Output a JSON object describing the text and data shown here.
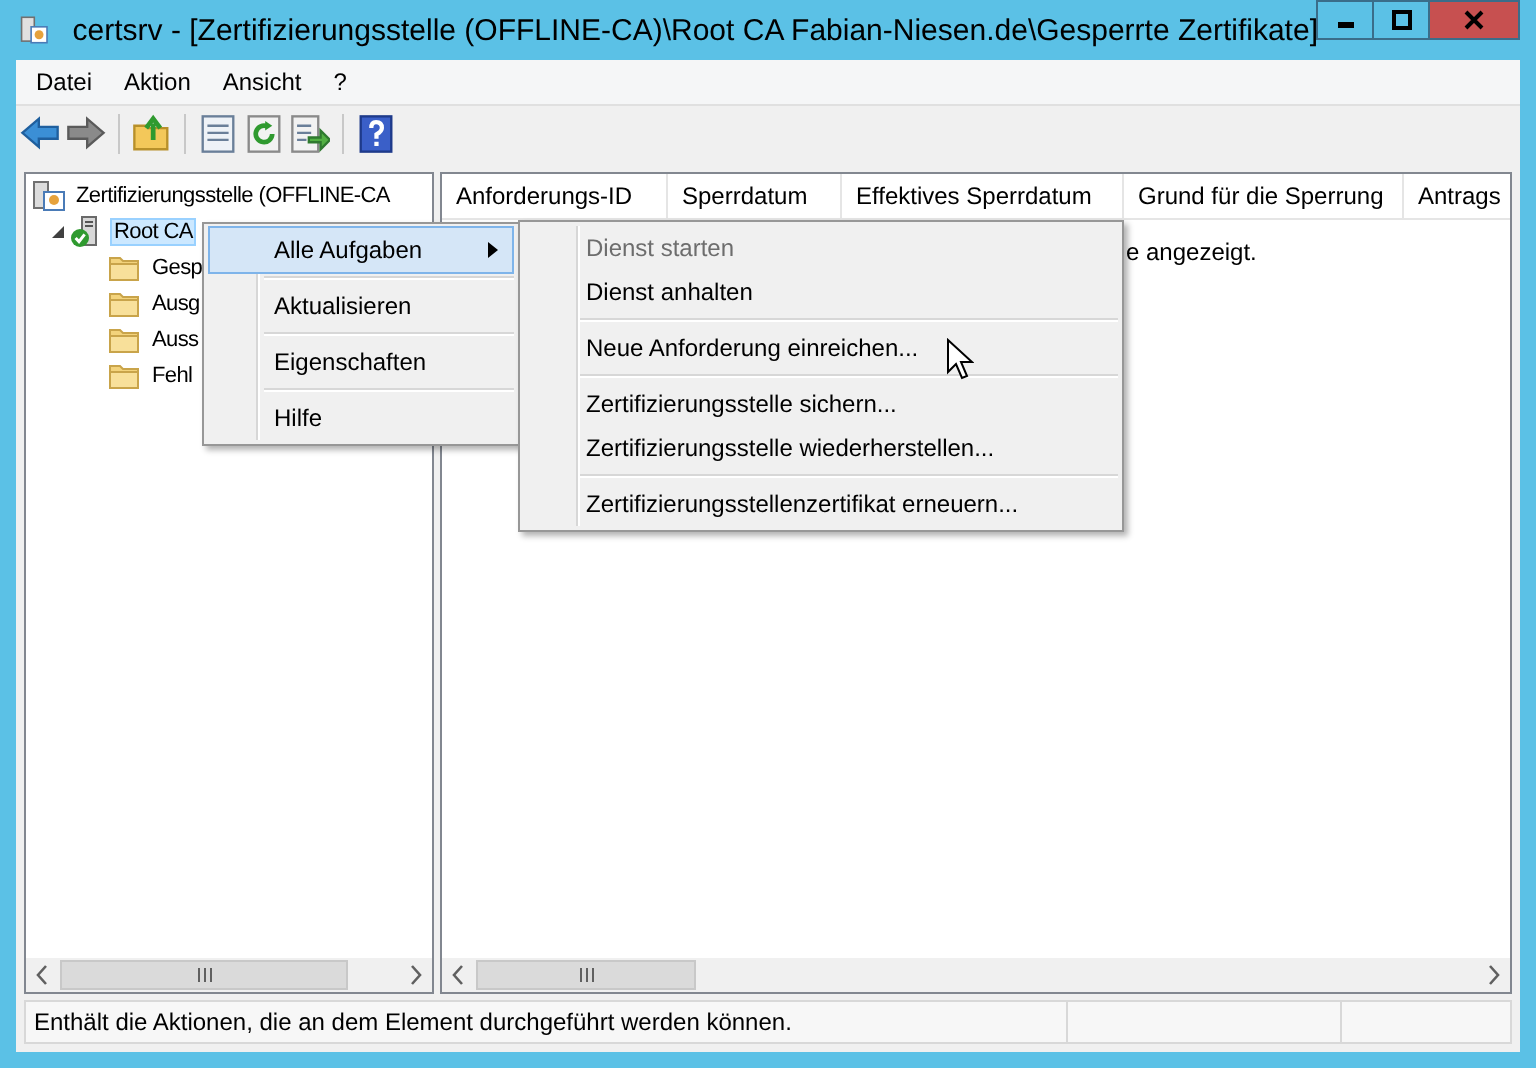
{
  "window": {
    "title": "certsrv - [Zertifizierungsstelle (OFFLINE-CA)\\Root CA Fabian-Niesen.de\\Gesperrte Zertifikate]"
  },
  "menu_bar": [
    "Datei",
    "Aktion",
    "Ansicht",
    "?"
  ],
  "tree": [
    {
      "label": "Zertifizierungsstelle (OFFLINE-CA",
      "selected": false,
      "children": [
        {
          "label": "Root CA",
          "selected": true,
          "expanded": true,
          "children": [
            {
              "label": "Gesp",
              "selected": false
            },
            {
              "label": "Ausg",
              "selected": false
            },
            {
              "label": "Auss",
              "selected": false
            },
            {
              "label": "Fehl",
              "selected": false
            }
          ]
        }
      ]
    }
  ],
  "table": {
    "columns": [
      "Anforderungs-ID",
      "Sperrdatum",
      "Effektives Sperrdatum",
      "Grund für die Sperrung",
      "Antrags"
    ],
    "message": "e angezeigt."
  },
  "context_menu": {
    "items": [
      {
        "kind": "item",
        "label": "Alle Aufgaben",
        "selected": true,
        "has_submenu": true
      },
      {
        "kind": "separator"
      },
      {
        "kind": "item",
        "label": "Aktualisieren",
        "selected": false,
        "has_submenu": false
      },
      {
        "kind": "separator"
      },
      {
        "kind": "item",
        "label": "Eigenschaften",
        "selected": false,
        "has_submenu": false
      },
      {
        "kind": "separator"
      },
      {
        "kind": "item",
        "label": "Hilfe",
        "selected": false,
        "has_submenu": false
      }
    ]
  },
  "submenu": {
    "items": [
      {
        "kind": "item",
        "label": "Dienst starten",
        "disabled": true
      },
      {
        "kind": "item",
        "label": "Dienst anhalten",
        "disabled": false
      },
      {
        "kind": "separator"
      },
      {
        "kind": "item",
        "label": "Neue Anforderung einreichen...",
        "disabled": false
      },
      {
        "kind": "separator"
      },
      {
        "kind": "item",
        "label": "Zertifizierungsstelle sichern...",
        "disabled": false
      },
      {
        "kind": "item",
        "label": "Zertifizierungsstelle wiederherstellen...",
        "disabled": false
      },
      {
        "kind": "separator"
      },
      {
        "kind": "item",
        "label": "Zertifizierungsstellenzertifikat erneuern...",
        "disabled": false
      }
    ]
  },
  "status_bar": {
    "text": "Enthält die Aktionen, die an dem Element durchgeführt werden können."
  }
}
